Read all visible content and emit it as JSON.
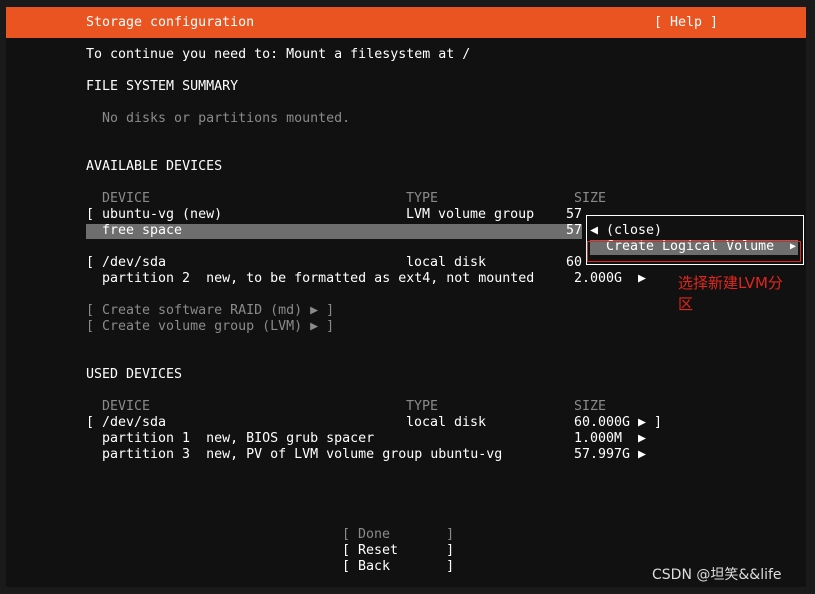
{
  "header": {
    "title": "Storage configuration",
    "help": "[ Help ]"
  },
  "instruction": "To continue you need to: Mount a filesystem at /",
  "fs_summary": {
    "heading": "FILE SYSTEM SUMMARY",
    "empty": "No disks or partitions mounted."
  },
  "available": {
    "heading": "AVAILABLE DEVICES",
    "columns": [
      "DEVICE",
      "TYPE",
      "SIZE"
    ],
    "rows": [
      {
        "bracket": "[",
        "device": "ubuntu-vg (new)",
        "type": "LVM volume group",
        "size": "57"
      },
      {
        "device": "free space",
        "size": "57"
      },
      {
        "bracket": "[",
        "device": "/dev/sda",
        "type": "local disk",
        "size": "60"
      },
      {
        "device": "partition 2  new, to be formatted as ext4, not mounted",
        "size": "2.000G",
        "arrow": "▶"
      }
    ],
    "actions": [
      "[ Create software RAID (md) ▶ ]",
      "[ Create volume group (LVM) ▶ ]"
    ]
  },
  "popup": {
    "close": "◀ (close)",
    "items": [
      "Create Logical Volume"
    ],
    "arrow": "▶"
  },
  "used": {
    "heading": "USED DEVICES",
    "columns": [
      "DEVICE",
      "TYPE",
      "SIZE"
    ],
    "rows": [
      {
        "bracket": "[",
        "device": "/dev/sda",
        "type": "local disk",
        "size": "60.000G",
        "arrow": "▶ ]"
      },
      {
        "device": "partition 1  new, BIOS grub spacer",
        "size": "1.000M",
        "arrow": "▶"
      },
      {
        "device": "partition 3  new, PV of LVM volume group ubuntu-vg",
        "size": "57.997G",
        "arrow": "▶"
      }
    ]
  },
  "buttons": {
    "done": "[ Done       ]",
    "reset": "[ Reset      ]",
    "back": "[ Back       ]"
  },
  "annotation": {
    "line1": "选择新建LVM分",
    "line2": "区"
  },
  "watermark": "CSDN @坦笑&&life",
  "colors": {
    "accent": "#e95420",
    "background": "#111111",
    "highlight": "#6e6e6e",
    "annotation": "#e0261e"
  }
}
